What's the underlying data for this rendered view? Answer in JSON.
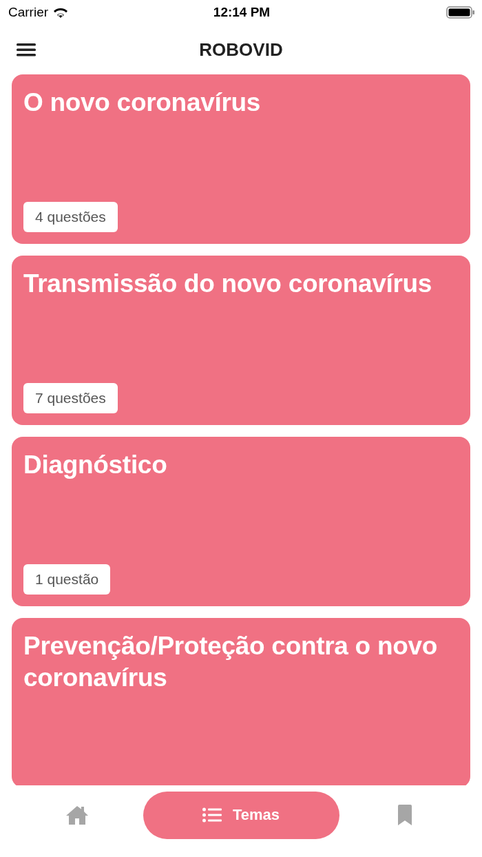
{
  "status_bar": {
    "carrier": "Carrier",
    "time": "12:14 PM"
  },
  "header": {
    "title": "ROBOVID"
  },
  "topics": [
    {
      "title": "O novo coronavírus",
      "count": "4 questões"
    },
    {
      "title": "Transmissão do novo coronavírus",
      "count": "7 questões"
    },
    {
      "title": "Diagnóstico",
      "count": "1 questão"
    },
    {
      "title": "Prevenção/Proteção contra o novo coronavírus"
    }
  ],
  "tab_bar": [
    {
      "kind": "home",
      "selected": false
    },
    {
      "kind": "list",
      "label": "Temas",
      "selected": true
    },
    {
      "kind": "bookmark",
      "selected": false
    }
  ]
}
